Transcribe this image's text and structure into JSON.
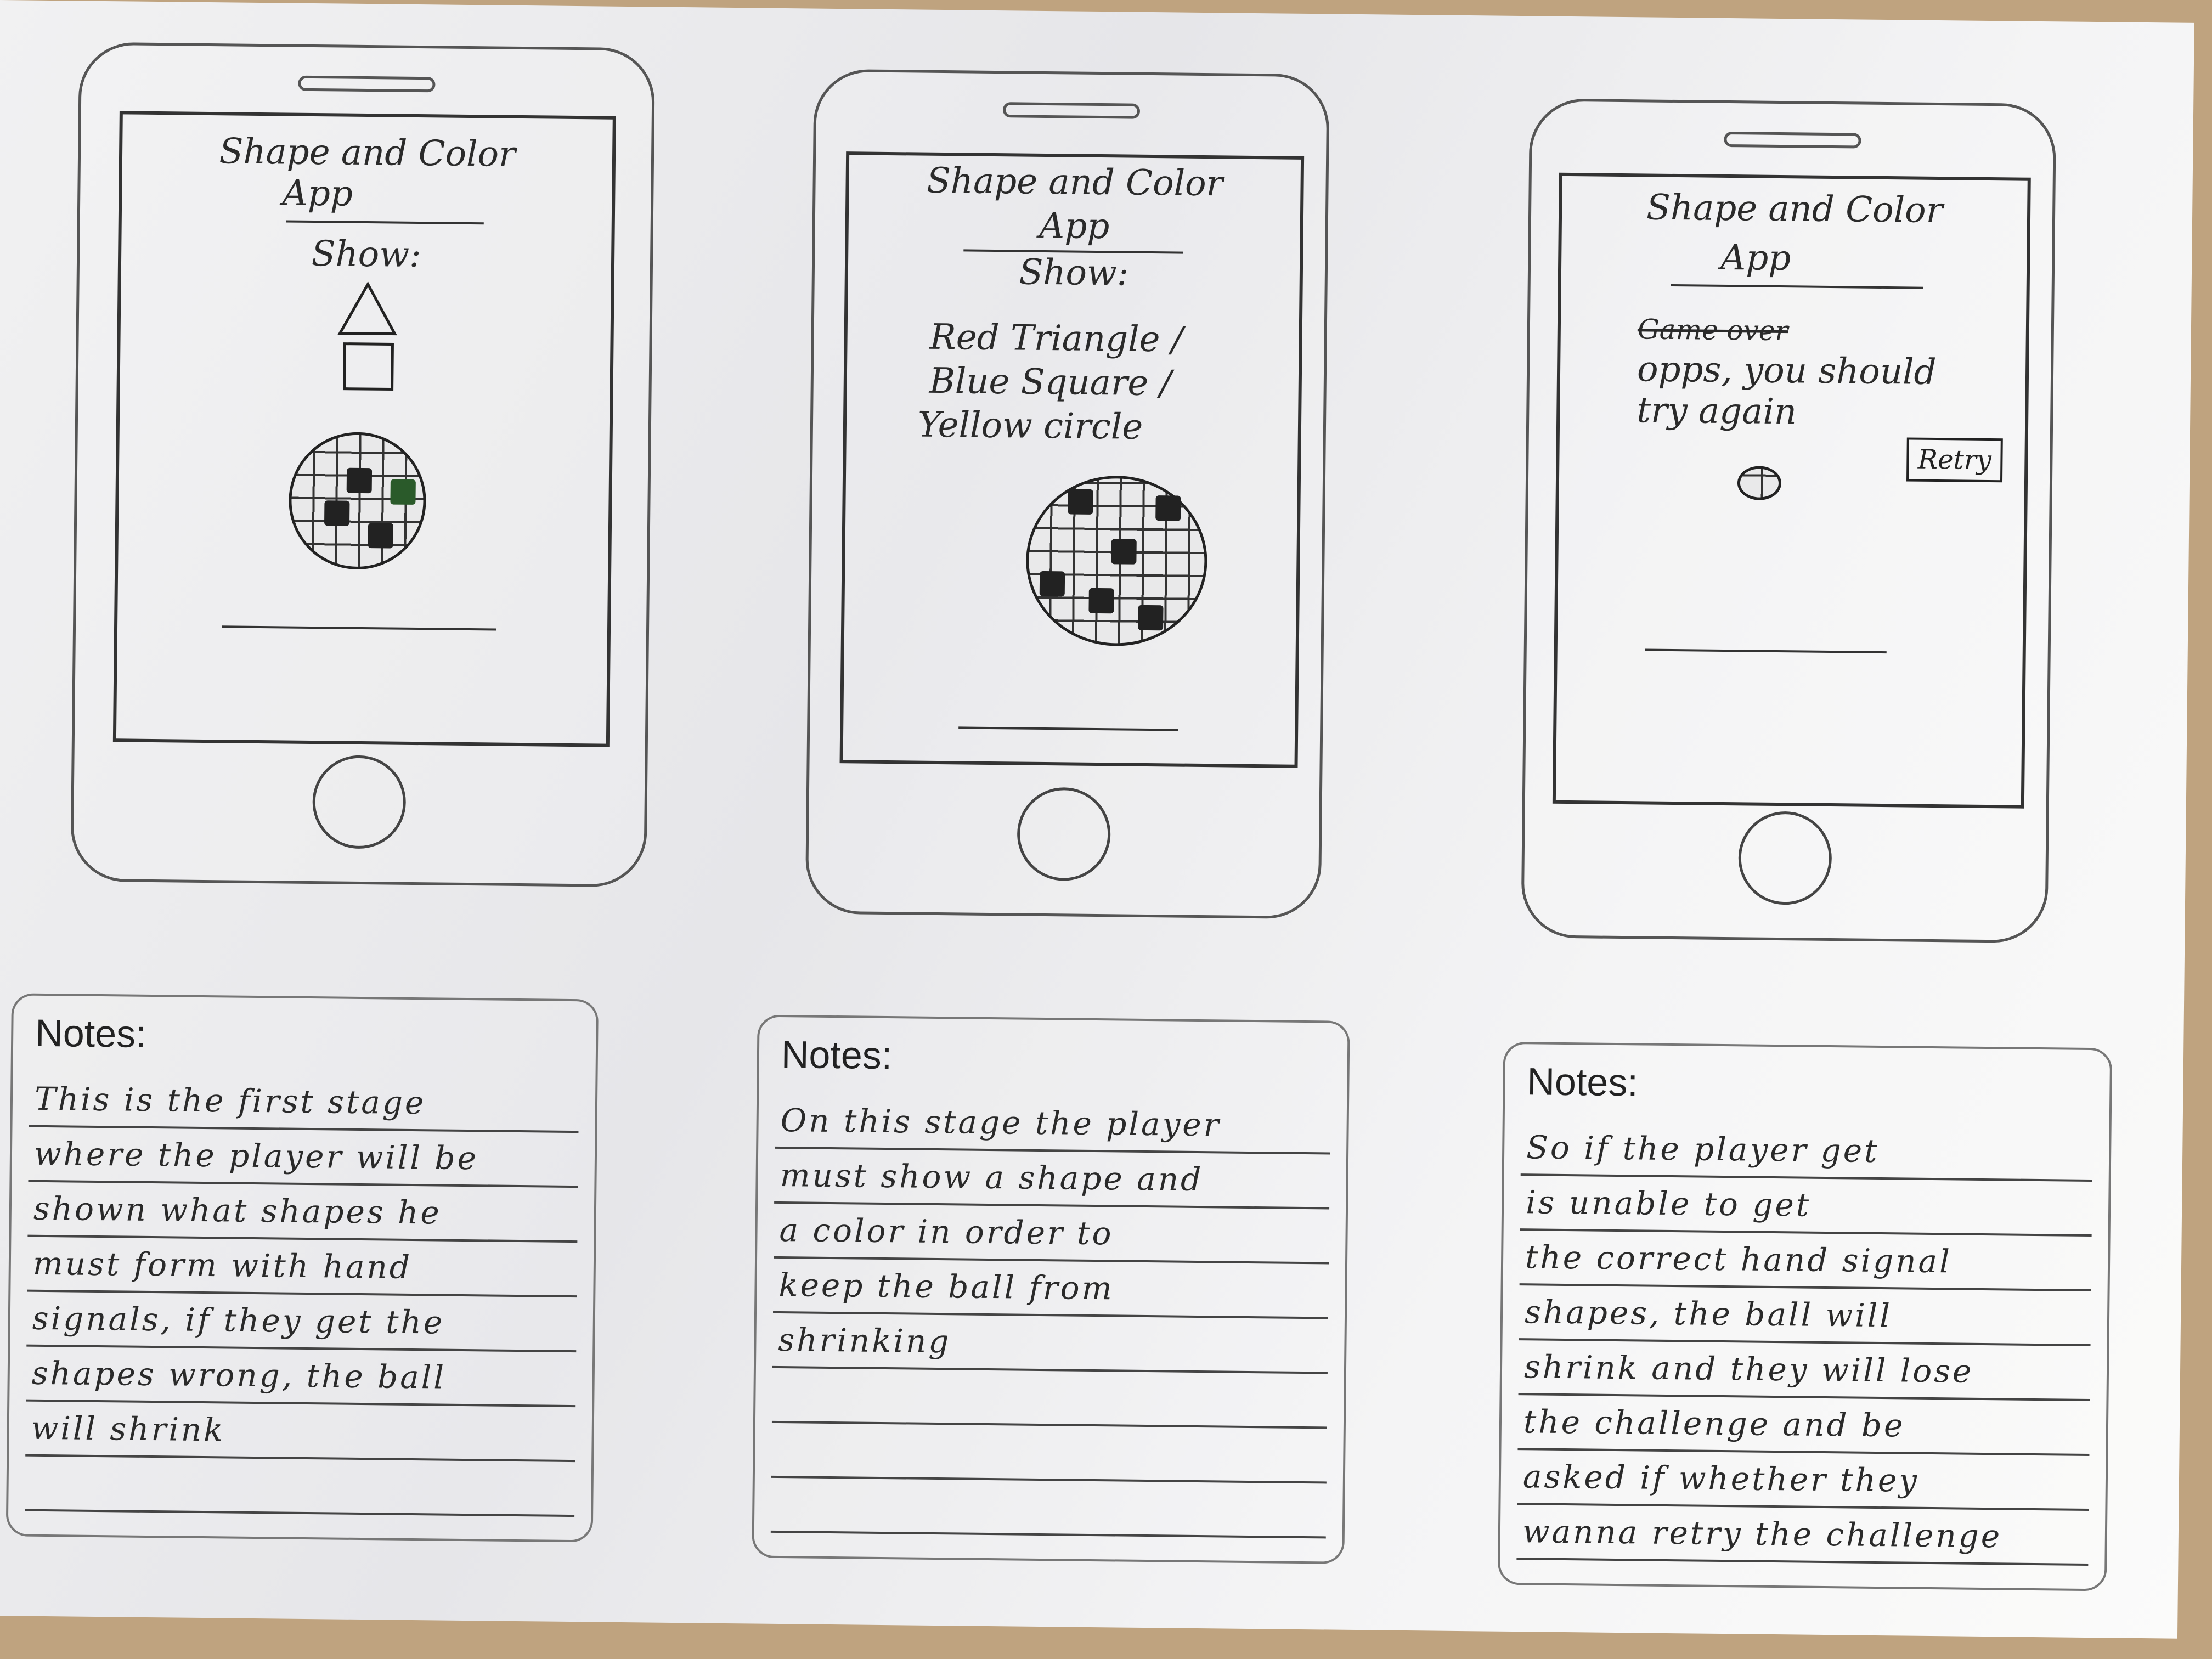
{
  "screens": [
    {
      "title_line1": "Shape and Color",
      "title_line2": "App",
      "show_label": "Show:",
      "shapes": [
        "triangle",
        "square"
      ]
    },
    {
      "title_line1": "Shape and Color",
      "title_line2": "App",
      "show_label": "Show:",
      "items": [
        "Red Triangle /",
        "Blue Square /",
        "Yellow circle"
      ]
    },
    {
      "title_line1": "Shape and Color",
      "title_line2": "App",
      "struck_text": "Game over",
      "message_line1": "opps, you should",
      "message_line2": "try again",
      "retry_label": "Retry"
    }
  ],
  "notes": [
    {
      "title": "Notes:",
      "lines": [
        "This is the first stage",
        "where the player will be",
        "shown what shapes he",
        "must form with hand",
        "signals, if they get the",
        "shapes wrong, the ball",
        "will shrink",
        ""
      ]
    },
    {
      "title": "Notes:",
      "lines": [
        "On this stage the player",
        "must show a shape and",
        "a color in order to",
        "keep the ball from",
        "shrinking",
        "",
        "",
        ""
      ]
    },
    {
      "title": "Notes:",
      "lines": [
        "So if the player get",
        "is unable to get",
        "the correct hand signal",
        "shapes, the ball will",
        "shrink and they will lose",
        "the challenge and be",
        "asked if whether they",
        "wanna retry the challenge"
      ]
    }
  ]
}
